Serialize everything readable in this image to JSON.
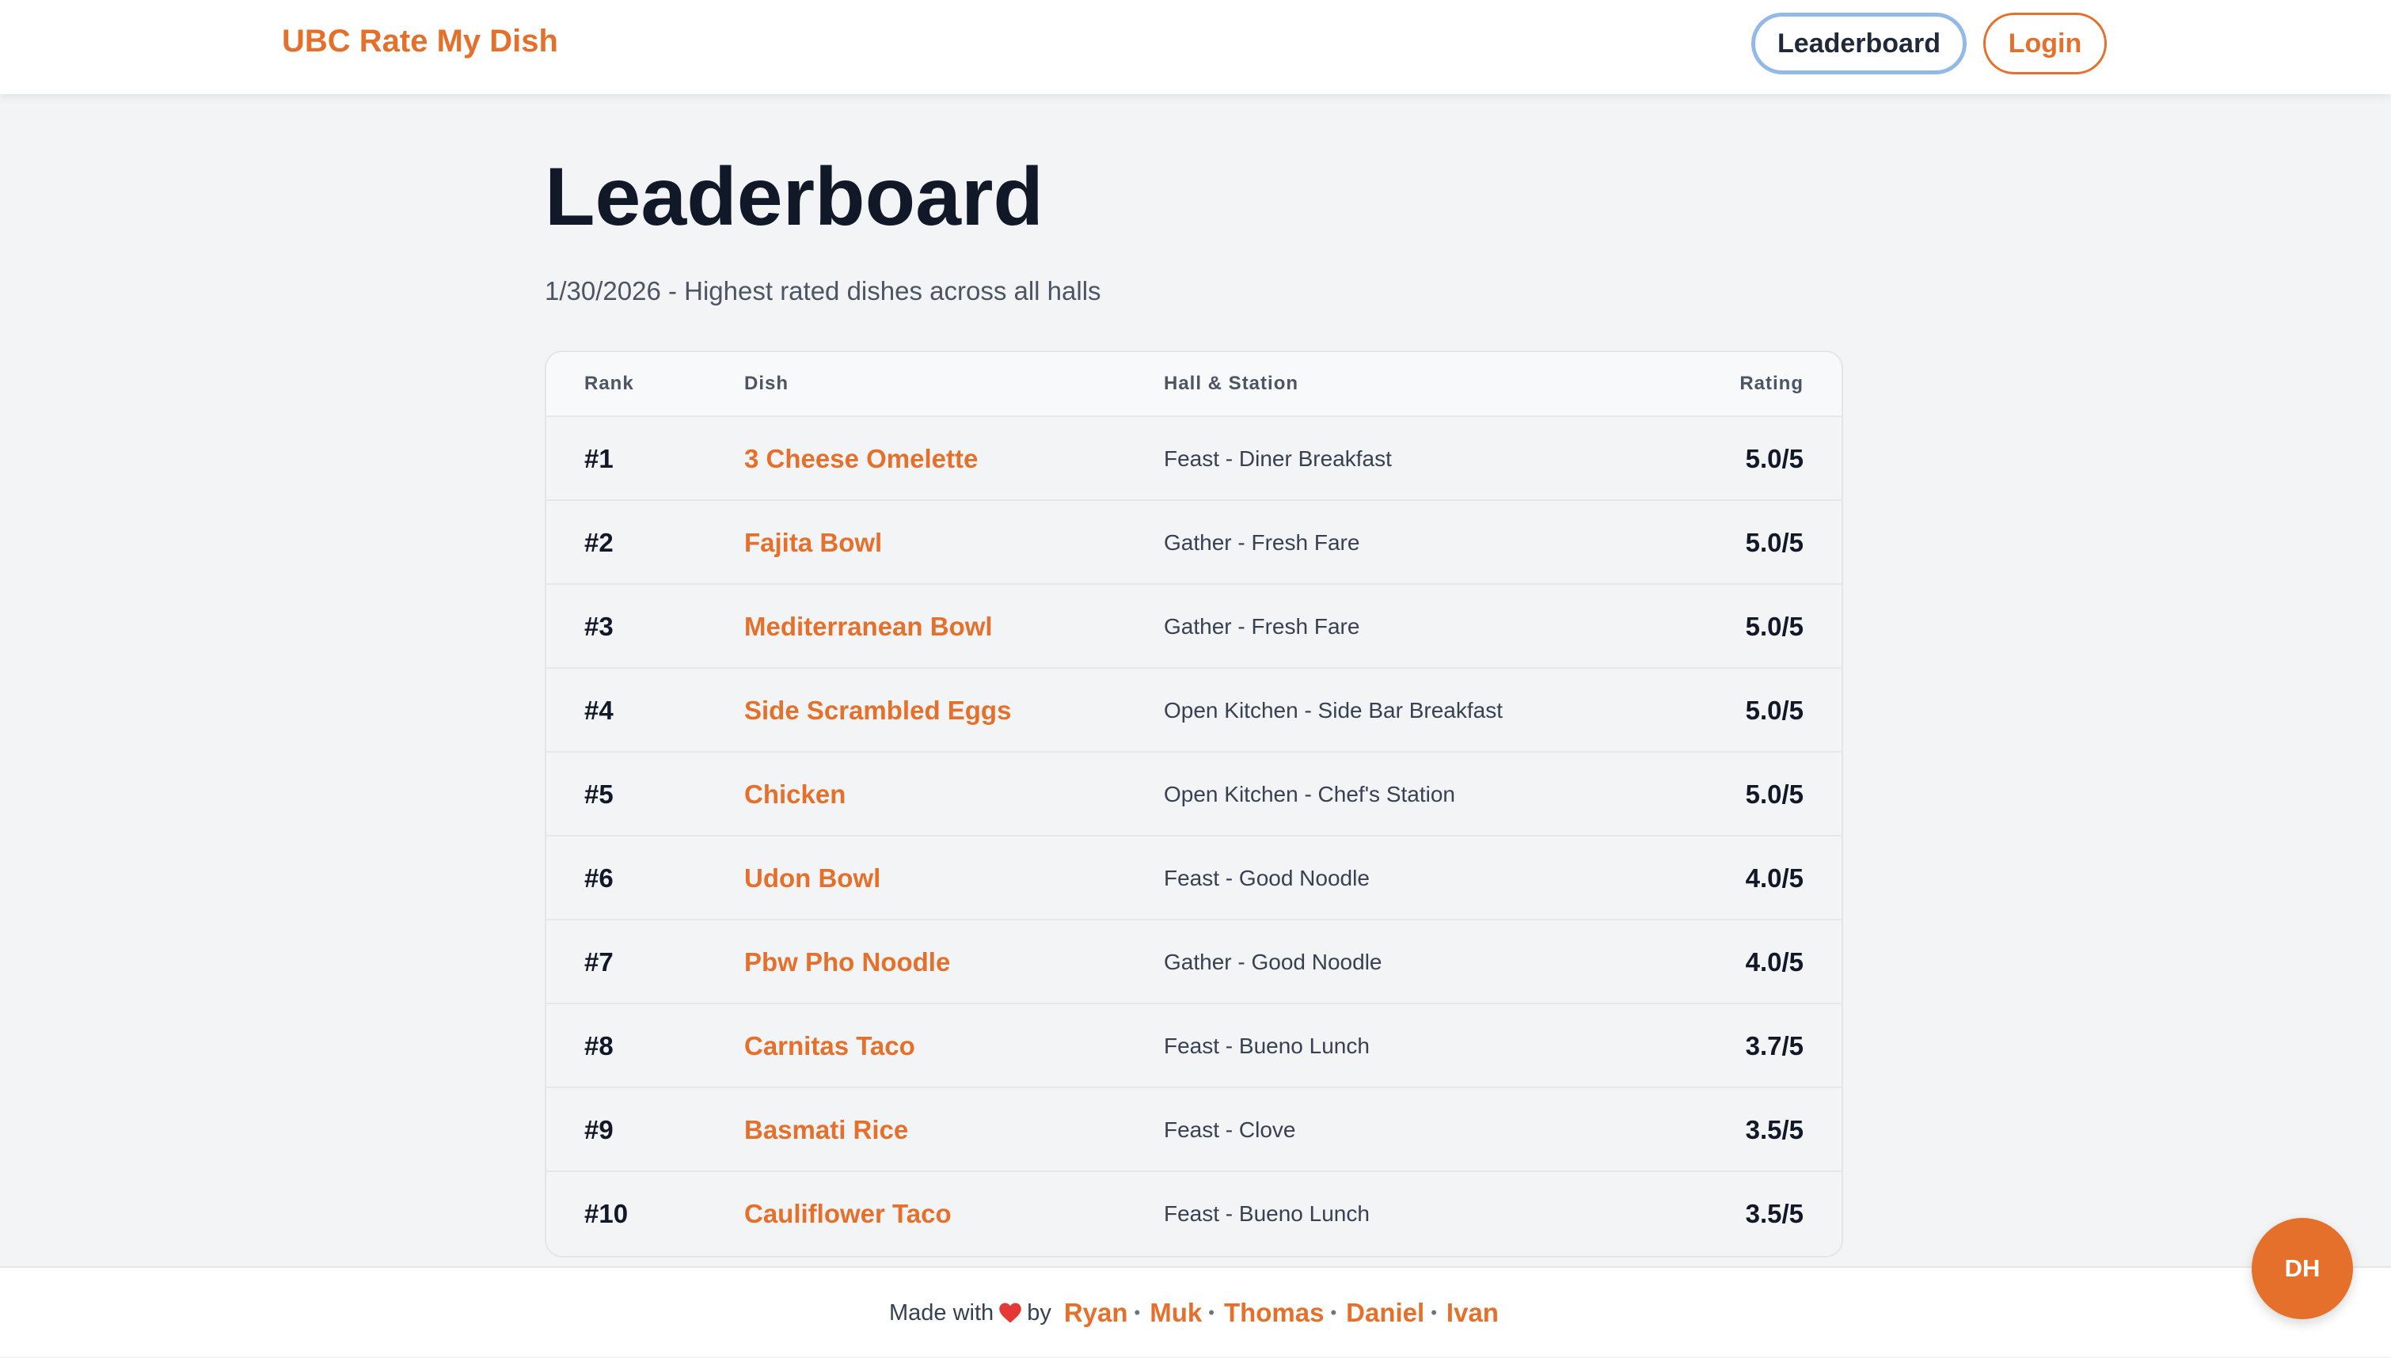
{
  "header": {
    "brand": "UBC Rate My Dish",
    "nav_leaderboard": "Leaderboard",
    "nav_login": "Login"
  },
  "main": {
    "title": "Leaderboard",
    "subtitle": "1/30/2026 - Highest rated dishes across all halls",
    "columns": [
      "Rank",
      "Dish",
      "Hall & Station",
      "Rating"
    ],
    "rows": [
      {
        "rank": "#1",
        "dish": "3 Cheese Omelette",
        "hall": "Feast - Diner Breakfast",
        "rating": "5.0/5"
      },
      {
        "rank": "#2",
        "dish": "Fajita Bowl",
        "hall": "Gather - Fresh Fare",
        "rating": "5.0/5"
      },
      {
        "rank": "#3",
        "dish": "Mediterranean Bowl",
        "hall": "Gather - Fresh Fare",
        "rating": "5.0/5"
      },
      {
        "rank": "#4",
        "dish": "Side Scrambled Eggs",
        "hall": "Open Kitchen - Side Bar Breakfast",
        "rating": "5.0/5"
      },
      {
        "rank": "#5",
        "dish": "Chicken",
        "hall": "Open Kitchen - Chef's Station",
        "rating": "5.0/5"
      },
      {
        "rank": "#6",
        "dish": "Udon Bowl",
        "hall": "Feast - Good Noodle",
        "rating": "4.0/5"
      },
      {
        "rank": "#7",
        "dish": "Pbw Pho Noodle",
        "hall": "Gather - Good Noodle",
        "rating": "4.0/5"
      },
      {
        "rank": "#8",
        "dish": "Carnitas Taco",
        "hall": "Feast - Bueno Lunch",
        "rating": "3.7/5"
      },
      {
        "rank": "#9",
        "dish": "Basmati Rice",
        "hall": "Feast - Clove",
        "rating": "3.5/5"
      },
      {
        "rank": "#10",
        "dish": "Cauliflower Taco",
        "hall": "Feast - Bueno Lunch",
        "rating": "3.5/5"
      }
    ]
  },
  "footer": {
    "made_with": "Made with",
    "by": "by",
    "heart_icon": "heart-icon",
    "authors": [
      "Ryan",
      "Muk",
      "Thomas",
      "Daniel",
      "Ivan"
    ],
    "separator": "•"
  },
  "avatar": {
    "initials": "DH"
  },
  "colors": {
    "accent": "#e5702b",
    "background": "#f3f4f6",
    "active_outline": "#93b9e6",
    "heart": "#e53935"
  }
}
